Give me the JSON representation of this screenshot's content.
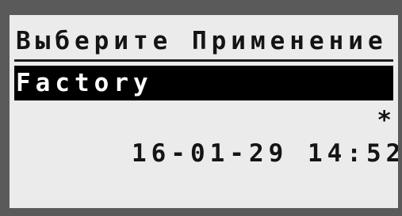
{
  "screen": {
    "title": "Выберите Применение",
    "selected_item": "Factory",
    "datetime": "16-01-29 14:52",
    "marker": "*"
  },
  "colors": {
    "bezel": "#5a5a5a",
    "lcd_background": "#ebebeb",
    "text": "#141414",
    "highlight_background": "#000000",
    "highlight_text": "#ffffff"
  }
}
